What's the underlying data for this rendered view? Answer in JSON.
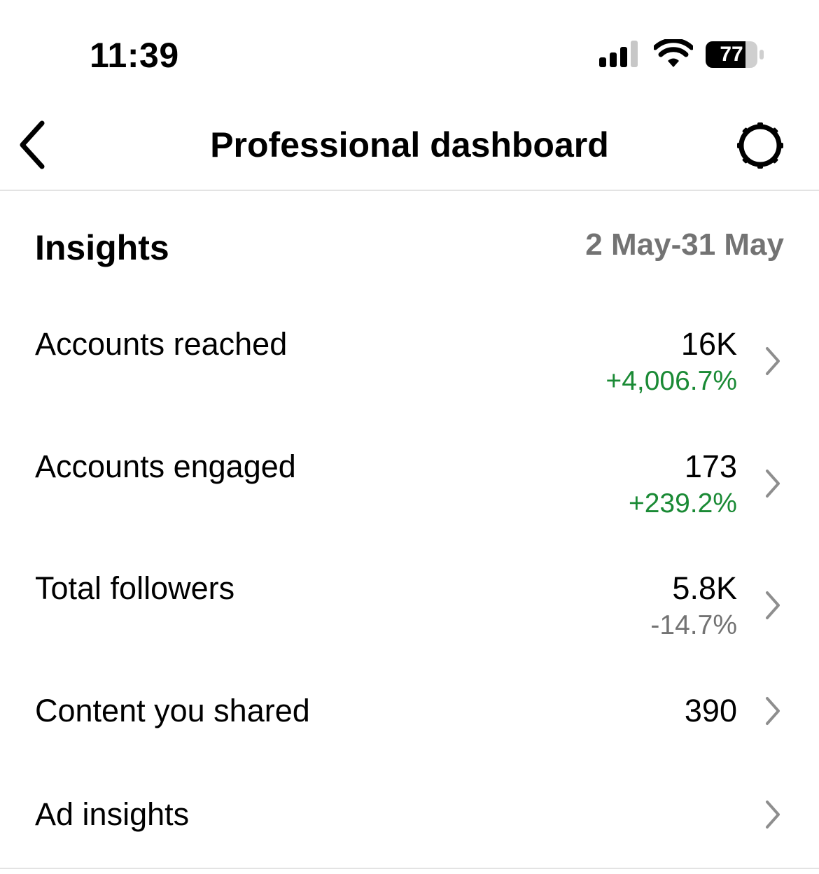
{
  "status_bar": {
    "time": "11:39",
    "battery_level": "77",
    "icons": [
      "signal-icon",
      "wifi-icon",
      "battery-icon"
    ]
  },
  "header": {
    "title": "Professional dashboard",
    "back_icon": "chevron-left-icon",
    "settings_icon": "settings-icon"
  },
  "insights": {
    "title": "Insights",
    "date_range": "2 May-31 May",
    "rows": [
      {
        "label": "Accounts reached",
        "value": "16K",
        "change": "+4,006.7%",
        "change_color": "#1a8a35"
      },
      {
        "label": "Accounts engaged",
        "value": "173",
        "change": "+239.2%",
        "change_color": "#1a8a35"
      },
      {
        "label": "Total followers",
        "value": "5.8K",
        "change": "-14.7%",
        "change_color": "#737373"
      },
      {
        "label": "Content you shared",
        "value": "390"
      },
      {
        "label": "Ad insights"
      }
    ]
  },
  "colors": {
    "positive": "#1a8a35",
    "neutral": "#737373",
    "divider": "#e3e3e3"
  }
}
